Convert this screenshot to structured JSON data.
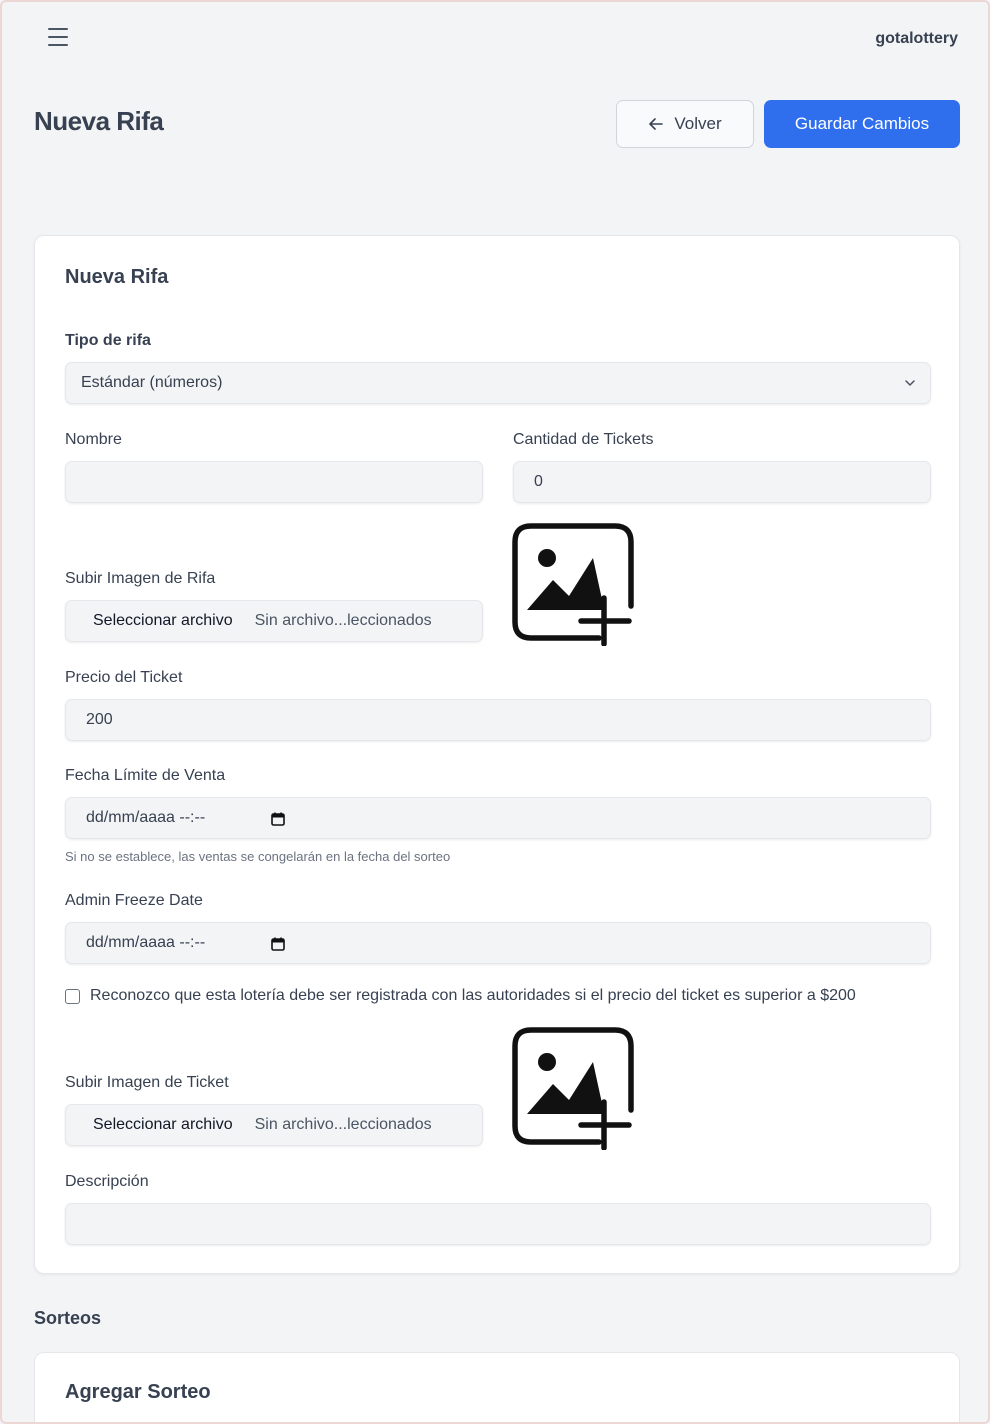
{
  "header": {
    "brand": "gotalottery",
    "page_title": "Nueva Rifa",
    "back_label": "Volver",
    "save_label": "Guardar Cambios"
  },
  "form": {
    "title": "Nueva Rifa",
    "tipo_label": "Tipo de rifa",
    "tipo_value": "Estándar (números)",
    "nombre_label": "Nombre",
    "nombre_value": "",
    "cantidad_label": "Cantidad de Tickets",
    "cantidad_value": "0",
    "imagen_rifa_label": "Subir Imagen de Rifa",
    "file_button": "Seleccionar archivo",
    "file_status": "Sin archivo...leccionados",
    "precio_label": "Precio del Ticket",
    "precio_value": "200",
    "fecha_label": "Fecha Límite de Venta",
    "fecha_placeholder": "dd/mm/aaaa --:--",
    "fecha_hint": "Si no se establece, las ventas se congelarán en la fecha del sorteo",
    "admin_freeze_label": "Admin Freeze Date",
    "admin_freeze_placeholder": "dd/mm/aaaa --:--",
    "checkbox_label": "Reconozco que esta lotería debe ser registrada con las autoridades si el precio del ticket es superior a $200",
    "imagen_ticket_label": "Subir Imagen de Ticket",
    "descripcion_label": "Descripción",
    "descripcion_value": ""
  },
  "sorteos": {
    "section_title": "Sorteos",
    "add_title": "Agregar Sorteo"
  },
  "colors": {
    "primary": "#2f6fed",
    "background": "#f3f4f6"
  }
}
